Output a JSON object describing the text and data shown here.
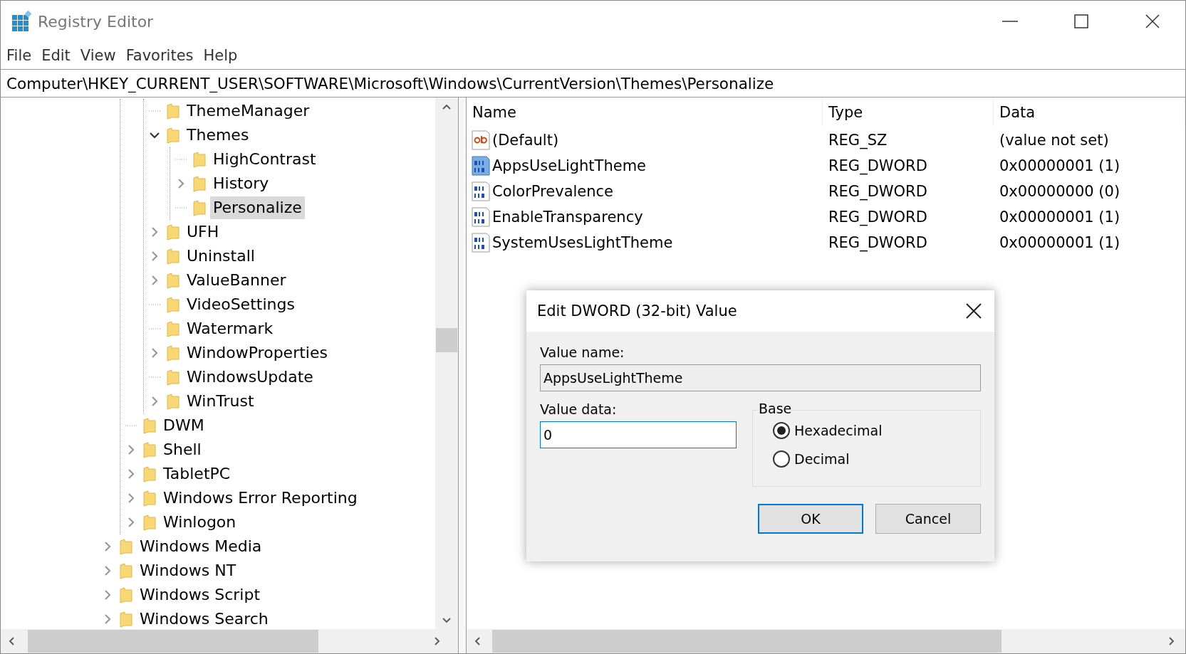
{
  "window": {
    "title": "Registry Editor"
  },
  "menu": [
    {
      "label": "File"
    },
    {
      "label": "Edit"
    },
    {
      "label": "View"
    },
    {
      "label": "Favorites"
    },
    {
      "label": "Help"
    }
  ],
  "address": "Computer\\HKEY_CURRENT_USER\\SOFTWARE\\Microsoft\\Windows\\CurrentVersion\\Themes\\Personalize",
  "tree": [
    {
      "children": [
        {
          "children": [
            {
              "label": "ThemeManager",
              "expandable": false,
              "selected": false
            },
            {
              "label": "Themes",
              "expandable": true,
              "expanded": true,
              "selected": false,
              "children": [
                {
                  "label": "HighContrast",
                  "expandable": false,
                  "selected": false
                },
                {
                  "label": "History",
                  "expandable": true,
                  "expanded": false,
                  "selected": false
                },
                {
                  "label": "Personalize",
                  "expandable": false,
                  "selected": true
                }
              ]
            },
            {
              "label": "UFH",
              "expandable": true,
              "expanded": false,
              "selected": false
            },
            {
              "label": "Uninstall",
              "expandable": true,
              "expanded": false,
              "selected": false
            },
            {
              "label": "ValueBanner",
              "expandable": true,
              "expanded": false,
              "selected": false
            },
            {
              "label": "VideoSettings",
              "expandable": false,
              "selected": false
            },
            {
              "label": "Watermark",
              "expandable": false,
              "selected": false
            },
            {
              "label": "WindowProperties",
              "expandable": true,
              "expanded": false,
              "selected": false
            },
            {
              "label": "WindowsUpdate",
              "expandable": false,
              "selected": false
            },
            {
              "label": "WinTrust",
              "expandable": true,
              "expanded": false,
              "selected": false
            }
          ]
        },
        {
          "label": "DWM",
          "expandable": false,
          "selected": false
        },
        {
          "label": "Shell",
          "expandable": true,
          "expanded": false,
          "selected": false
        },
        {
          "label": "TabletPC",
          "expandable": true,
          "expanded": false,
          "selected": false
        },
        {
          "label": "Windows Error Reporting",
          "expandable": true,
          "expanded": false,
          "selected": false
        },
        {
          "label": "Winlogon",
          "expandable": true,
          "expanded": false,
          "selected": false
        }
      ]
    },
    {
      "label": "Windows Media",
      "expandable": true,
      "expanded": false,
      "selected": false
    },
    {
      "label": "Windows NT",
      "expandable": true,
      "expanded": false,
      "selected": false
    },
    {
      "label": "Windows Script",
      "expandable": true,
      "expanded": false,
      "selected": false
    },
    {
      "label": "Windows Search",
      "expandable": true,
      "expanded": false,
      "selected": false
    }
  ],
  "values": {
    "columns": [
      "Name",
      "Type",
      "Data"
    ],
    "rows": [
      {
        "kind": "string",
        "name": "(Default)",
        "type": "REG_SZ",
        "data": "(value not set)",
        "selected": false
      },
      {
        "kind": "binary",
        "name": "AppsUseLightTheme",
        "type": "REG_DWORD",
        "data": "0x00000001 (1)",
        "selected": true
      },
      {
        "kind": "binary",
        "name": "ColorPrevalence",
        "type": "REG_DWORD",
        "data": "0x00000000 (0)",
        "selected": false
      },
      {
        "kind": "binary",
        "name": "EnableTransparency",
        "type": "REG_DWORD",
        "data": "0x00000001 (1)",
        "selected": false
      },
      {
        "kind": "binary",
        "name": "SystemUsesLightTheme",
        "type": "REG_DWORD",
        "data": "0x00000001 (1)",
        "selected": false
      }
    ]
  },
  "dialog": {
    "title": "Edit DWORD (32-bit) Value",
    "value_name_label": "Value name:",
    "value_name": "AppsUseLightTheme",
    "value_data_label": "Value data:",
    "value_data": "0",
    "base_label": "Base",
    "bases": [
      {
        "label": "Hexadecimal",
        "selected": true
      },
      {
        "label": "Decimal",
        "selected": false
      }
    ],
    "buttons": [
      {
        "label": "OK",
        "default": true
      },
      {
        "label": "Cancel",
        "default": false
      }
    ]
  }
}
